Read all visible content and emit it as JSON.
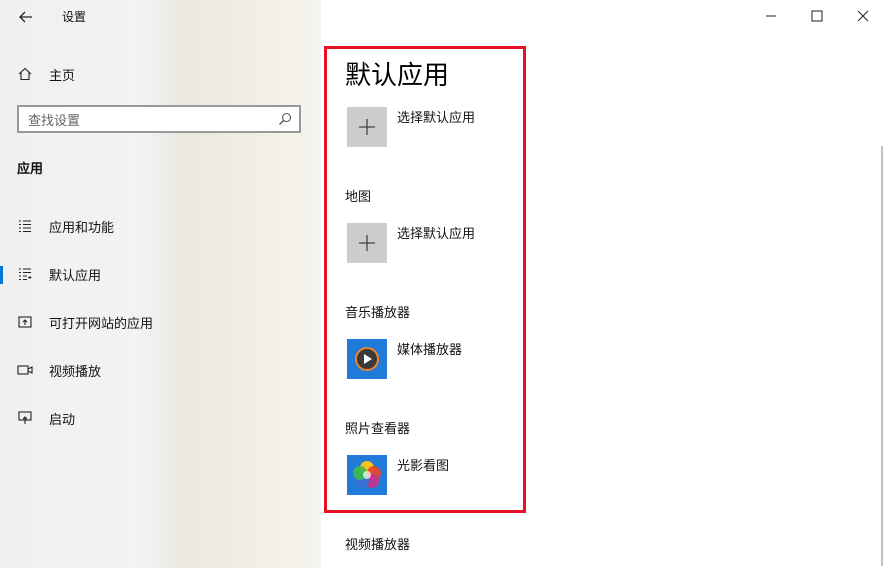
{
  "window": {
    "title": "设置"
  },
  "sidebar": {
    "home": "主页",
    "search": {
      "placeholder": "查找设置"
    },
    "section_title": "应用",
    "items": [
      {
        "label": "应用和功能",
        "icon": "apps-features-icon"
      },
      {
        "label": "默认应用",
        "icon": "default-apps-icon",
        "active": true
      },
      {
        "label": "可打开网站的应用",
        "icon": "apps-for-websites-icon"
      },
      {
        "label": "视频播放",
        "icon": "video-playback-icon"
      },
      {
        "label": "启动",
        "icon": "startup-icon"
      }
    ]
  },
  "main": {
    "title": "默认应用",
    "groups": [
      {
        "label": "",
        "app": "选择默认应用",
        "icon": "plus-icon"
      },
      {
        "label": "地图",
        "app": "选择默认应用",
        "icon": "plus-icon"
      },
      {
        "label": "音乐播放器",
        "app": "媒体播放器",
        "icon": "media-player-icon"
      },
      {
        "label": "照片查看器",
        "app": "光影看图",
        "icon": "photo-viewer-icon"
      },
      {
        "label": "视频播放器"
      }
    ]
  },
  "colors": {
    "accent": "#0078d7",
    "highlight_border": "#e81123",
    "plus_tile": "#cccccc"
  }
}
